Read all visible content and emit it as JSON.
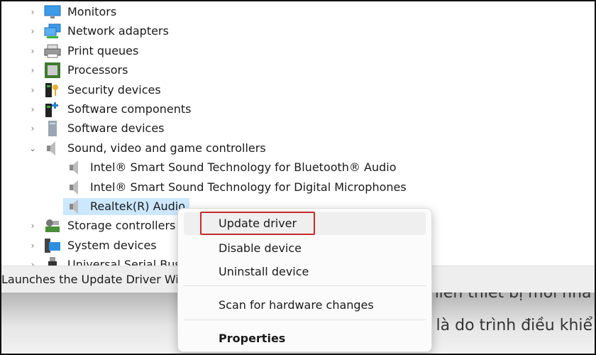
{
  "tree": {
    "categories": [
      {
        "label": "Monitors",
        "icon": "monitor-icon",
        "expanded": false
      },
      {
        "label": "Network adapters",
        "icon": "network-icon",
        "expanded": false
      },
      {
        "label": "Print queues",
        "icon": "printer-icon",
        "expanded": false
      },
      {
        "label": "Processors",
        "icon": "processor-icon",
        "expanded": false
      },
      {
        "label": "Security devices",
        "icon": "security-key-icon",
        "expanded": false
      },
      {
        "label": "Software components",
        "icon": "software-component-icon",
        "expanded": false
      },
      {
        "label": "Software devices",
        "icon": "software-device-icon",
        "expanded": false
      },
      {
        "label": "Sound, video and game controllers",
        "icon": "speaker-icon",
        "expanded": true
      }
    ],
    "children": [
      {
        "label": "Intel® Smart Sound Technology for Bluetooth® Audio",
        "icon": "speaker-icon"
      },
      {
        "label": "Intel® Smart Sound Technology for Digital Microphones",
        "icon": "speaker-icon"
      },
      {
        "label": "Realtek(R) Audio",
        "icon": "speaker-icon",
        "selected": true
      }
    ],
    "more": [
      {
        "label": "Storage controllers",
        "icon": "storage-icon"
      },
      {
        "label": "System devices",
        "icon": "system-icon"
      },
      {
        "label": "Universal Serial Bus",
        "icon": "usb-icon"
      }
    ]
  },
  "status_text": "Launches the Update Driver Wiz",
  "background_text": [
    "khiển thiết bị mới nhấ",
    "ể là do trình điều khiể"
  ],
  "context_menu": {
    "items": [
      "Update driver",
      "Disable device",
      "Uninstall device",
      "Scan for hardware changes",
      "Properties"
    ],
    "highlight_color": "#c42b2b"
  },
  "colors": {
    "selection": "#cce8ff",
    "status_bar": "#eeeeee"
  }
}
